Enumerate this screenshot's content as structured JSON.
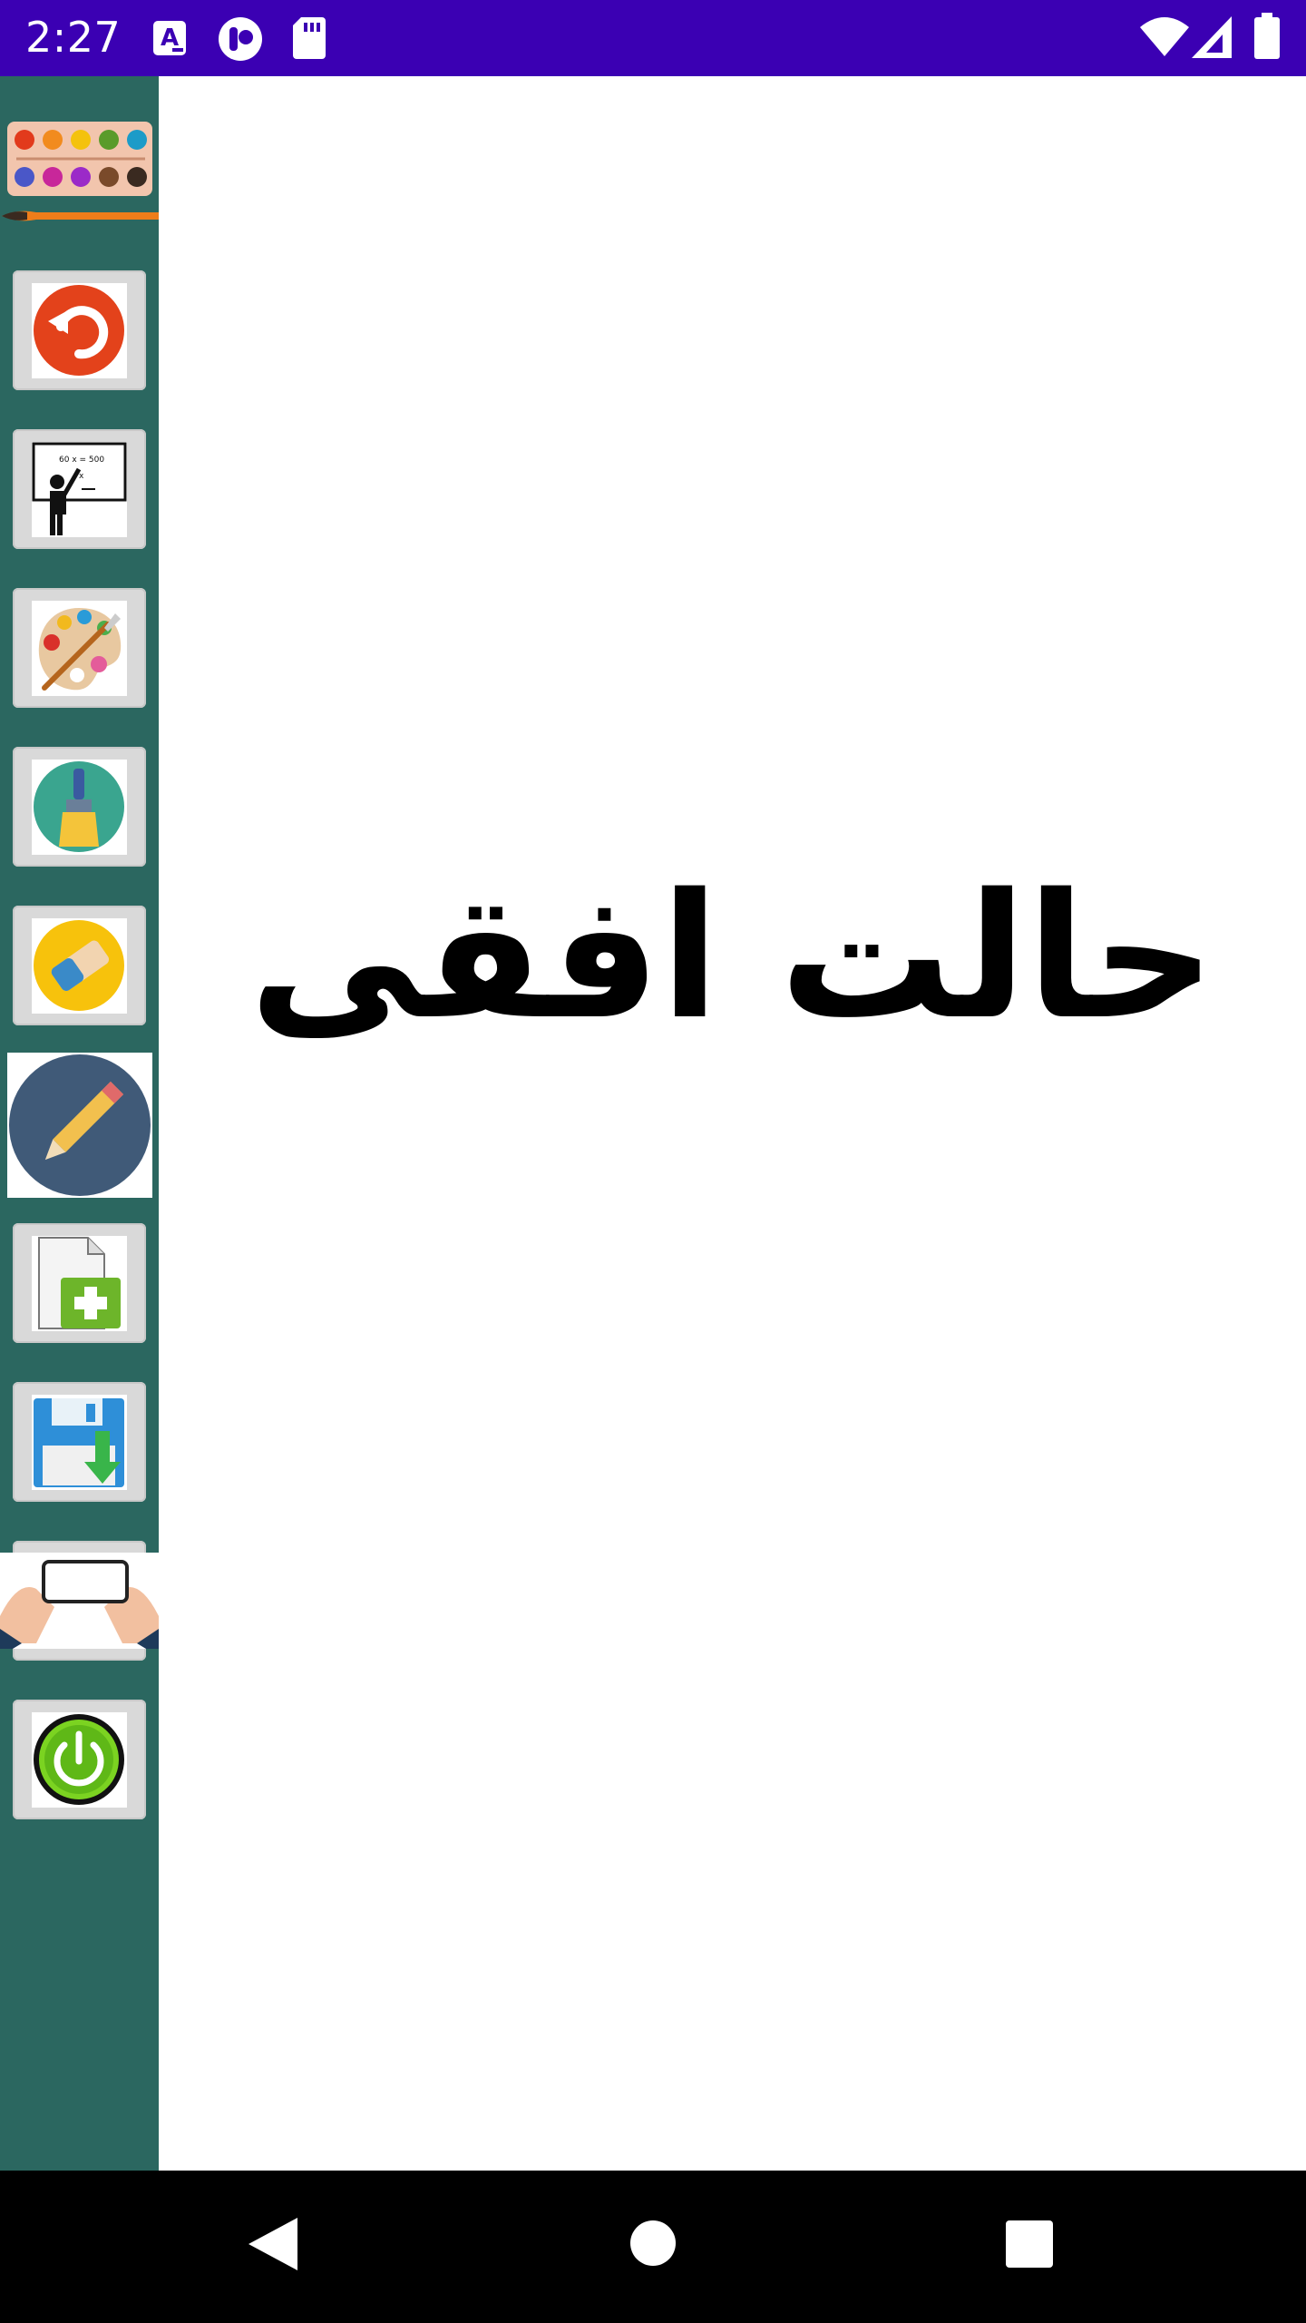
{
  "status_bar": {
    "time": "2:27",
    "icons": [
      "notification-a-icon",
      "app-icon",
      "sd-card-icon",
      "wifi-icon",
      "signal-icon",
      "battery-icon"
    ]
  },
  "sidebar": {
    "logo": "paint-palette-brush-logo",
    "tools": [
      {
        "name": "undo",
        "icon": "undo-icon"
      },
      {
        "name": "board",
        "icon": "teacher-board-icon"
      },
      {
        "name": "color",
        "icon": "palette-icon"
      },
      {
        "name": "brush",
        "icon": "brush-icon"
      },
      {
        "name": "eraser",
        "icon": "eraser-icon"
      },
      {
        "name": "pencil",
        "icon": "pencil-icon"
      },
      {
        "name": "new-file",
        "icon": "new-file-icon"
      },
      {
        "name": "save",
        "icon": "save-icon"
      },
      {
        "name": "orientation",
        "icon": "phone-landscape-icon"
      },
      {
        "name": "exit",
        "icon": "power-icon"
      }
    ]
  },
  "canvas": {
    "title": "حالت افقی"
  },
  "colors": {
    "status_bar": "#3b00b3",
    "sidebar": "#2b6760",
    "button_bg": "#d9d9d9",
    "nav_bar": "#000000"
  }
}
